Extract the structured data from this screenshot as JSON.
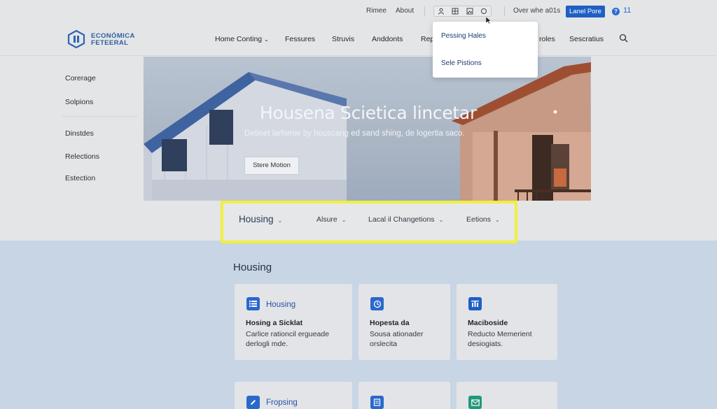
{
  "topbar": {
    "links": [
      "Rimee",
      "About"
    ],
    "overview_text": "Over whe a01s",
    "login_label": "Lanel Pore",
    "help_count": "11"
  },
  "header": {
    "logo_line1": "ECONÓMICA",
    "logo_line2": "FETEERAL",
    "nav": [
      {
        "label": "Home Conting",
        "has_dropdown": true
      },
      {
        "label": "Fessures"
      },
      {
        "label": "Struvis"
      },
      {
        "label": "Anddonts"
      },
      {
        "label": "Rep"
      },
      {
        "label": "roles"
      },
      {
        "label": "Sescratius"
      }
    ]
  },
  "dropdown": {
    "items": [
      "Pessing Hales",
      "Sele Pistions"
    ]
  },
  "sidebar": {
    "items": [
      "Coreragе",
      "Solpions",
      "Dinstdes",
      "Relections",
      "Estection"
    ]
  },
  "hero": {
    "title": "Housena Scietica lincetar",
    "subtitle": "Detinet larfomie by houscarig ed sand shing, de logertia saco.",
    "button_label": "Stere Motion"
  },
  "filters": {
    "primary": "Housing",
    "items": [
      "Alsure",
      "Lacal il Changetions",
      "Eetions"
    ]
  },
  "section": {
    "title": "Housing",
    "cards": [
      {
        "icon": "list-icon",
        "label": "Housing",
        "title": "Hosing a Sicklat",
        "desc": "Carlice rationcil erguеade derlogli mde."
      },
      {
        "icon": "clock-icon",
        "label": "",
        "title": "Hopesta da",
        "desc": "Sousa ationader orslecita"
      },
      {
        "icon": "building-icon",
        "label": "",
        "title": "Maciboside",
        "desc": "Reducto Memerient desiogiats."
      },
      {
        "icon": "pencil-icon",
        "label": "Fropsing",
        "title": "",
        "desc": ""
      },
      {
        "icon": "document-icon",
        "label": "",
        "title": "",
        "desc": ""
      },
      {
        "icon": "mail-icon",
        "label": "",
        "title": "",
        "desc": ""
      }
    ]
  },
  "colors": {
    "accent": "#1f5fc4",
    "highlight": "#f0f03c",
    "lower_bg": "#c7d5e4",
    "icon_green": "#1e9a7a"
  }
}
